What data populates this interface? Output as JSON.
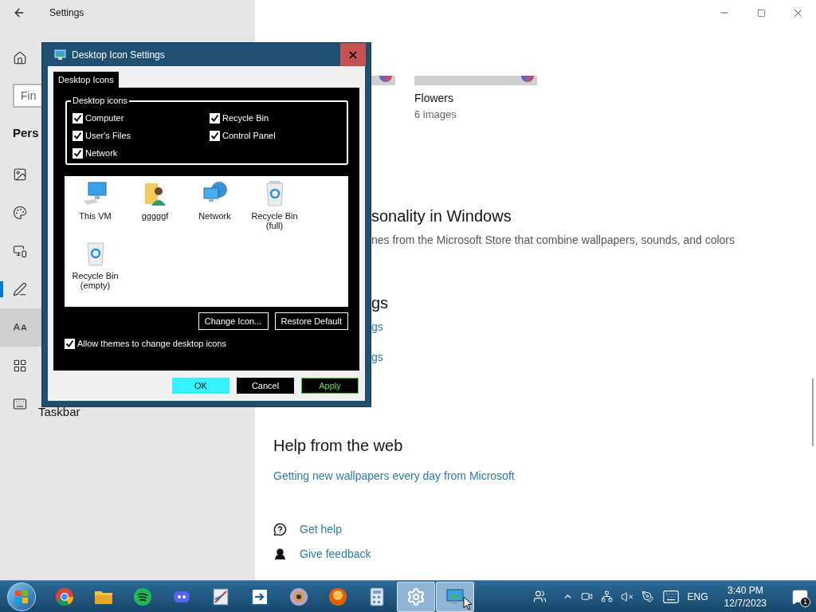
{
  "settings": {
    "title": "Settings",
    "search_placeholder": "Fin",
    "section": "Pers",
    "nav": [
      {
        "kind": "background",
        "selected": false,
        "hovered": false
      },
      {
        "kind": "colors",
        "selected": false,
        "hovered": false
      },
      {
        "kind": "lock-screen",
        "selected": false,
        "hovered": false
      },
      {
        "kind": "themes",
        "selected": true,
        "hovered": false
      },
      {
        "kind": "fonts",
        "selected": false,
        "hovered": true
      },
      {
        "kind": "start",
        "selected": false,
        "hovered": false
      },
      {
        "kind": "taskbar",
        "label": "Taskbar",
        "selected": false,
        "hovered": false
      }
    ],
    "theme_card": {
      "name": "Flowers",
      "count": "6 images"
    },
    "store_heading": "sonality in Windows",
    "store_text": "nes from the Microsoft Store that combine wallpapers, sounds, and colors",
    "related_heading": "gs",
    "related_links": [
      "gs",
      "gs"
    ],
    "help_heading": "Help from the web",
    "help_links": [
      "Getting new wallpapers every day from Microsoft"
    ],
    "support_links": [
      {
        "kind": "help",
        "label": "Get help"
      },
      {
        "kind": "feedback",
        "label": "Give feedback"
      }
    ]
  },
  "dialog": {
    "title": "Desktop Icon Settings",
    "tabs": [
      {
        "label": "Desktop Icons",
        "selected": true
      }
    ],
    "group_label": "Desktop icons",
    "checkboxes": [
      {
        "label": "Computer",
        "checked": true
      },
      {
        "label": "Recycle Bin",
        "checked": true
      },
      {
        "label": "User's Files",
        "checked": true
      },
      {
        "label": "Control Panel",
        "checked": true
      },
      {
        "label": "Network",
        "checked": true
      }
    ],
    "icons": [
      {
        "kind": "computer",
        "label": "This VM"
      },
      {
        "kind": "user-folder",
        "label": "gggggf"
      },
      {
        "kind": "network",
        "label": "Network"
      },
      {
        "kind": "recycle-full",
        "label": "Recycle Bin (full)"
      },
      {
        "kind": "recycle-empty",
        "label": "Recycle Bin (empty)"
      }
    ],
    "icon_buttons": [
      "Change Icon...",
      "Restore Default"
    ],
    "allow_themes": {
      "label": "Allow themes to change desktop icons",
      "checked": true
    },
    "buttons": [
      {
        "kind": "default",
        "label": "OK"
      },
      {
        "kind": "normal",
        "label": "Cancel"
      },
      {
        "kind": "apply",
        "label": "Apply"
      }
    ]
  },
  "taskbar": {
    "apps": [
      {
        "kind": "chrome",
        "active": false
      },
      {
        "kind": "explorer",
        "active": false
      },
      {
        "kind": "spotify",
        "active": false
      },
      {
        "kind": "discord",
        "active": false
      },
      {
        "kind": "paint",
        "active": false
      },
      {
        "kind": "remote",
        "active": false
      },
      {
        "kind": "disc",
        "active": false
      },
      {
        "kind": "firefox",
        "active": false
      },
      {
        "kind": "calculator",
        "active": false
      },
      {
        "kind": "settings",
        "active": true
      },
      {
        "kind": "display",
        "active": true
      }
    ],
    "language": "ENG",
    "time": "3:40 PM",
    "date": "12/7/2023",
    "notifications": "1"
  }
}
